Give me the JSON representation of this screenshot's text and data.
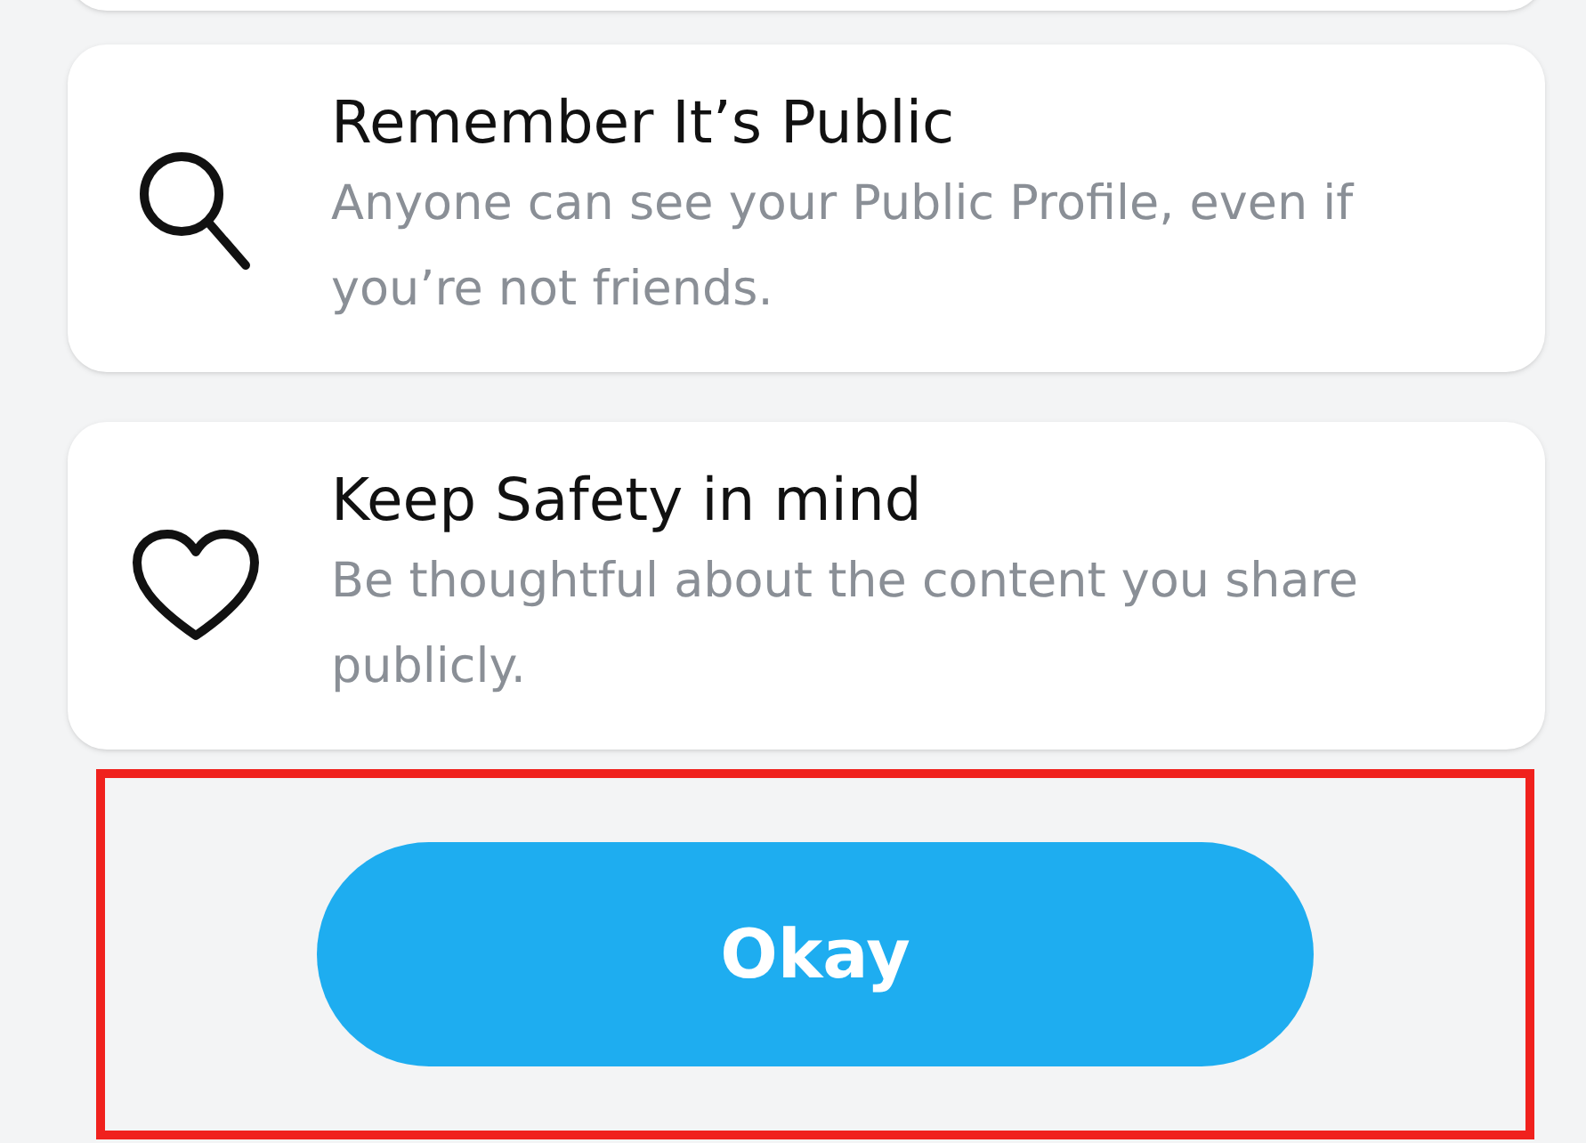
{
  "tips": [
    {
      "kind": "search",
      "title": "Remember It’s Public",
      "body": "Anyone can see your Public Profile, even if you’re not friends."
    },
    {
      "kind": "heart",
      "title": "Keep Safety in mind",
      "body": "Be thoughtful about the content you share publicly."
    }
  ],
  "button": {
    "label": "Okay",
    "highlighted": true
  }
}
